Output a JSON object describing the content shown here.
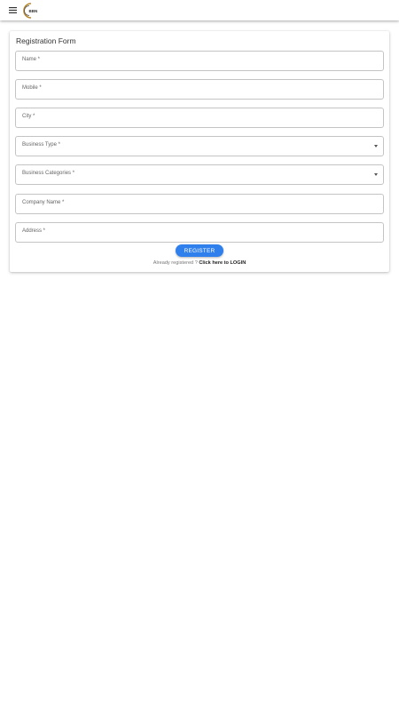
{
  "appbar": {
    "menu_icon": "hamburger-menu-icon",
    "logo_text": "BBN",
    "logo_color": "#b8862b"
  },
  "form": {
    "title": "Registration Form",
    "fields": [
      {
        "label": "Name *",
        "type": "text"
      },
      {
        "label": "Mobile *",
        "type": "text"
      },
      {
        "label": "City *",
        "type": "text"
      },
      {
        "label": "Business Type *",
        "type": "select"
      },
      {
        "label": "Business Categories *",
        "type": "select"
      },
      {
        "label": "Company Name *",
        "type": "text"
      },
      {
        "label": "Address *",
        "type": "text"
      }
    ],
    "register_label": "REGISTER",
    "register_color": "#2f80ed",
    "login_prompt": "Already registered ?",
    "login_link": "Click here to LOGIN"
  }
}
